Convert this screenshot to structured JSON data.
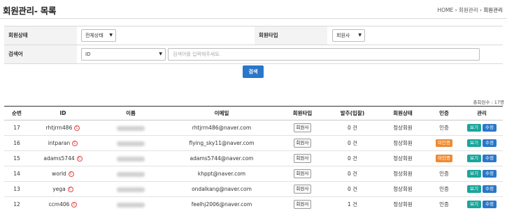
{
  "page": {
    "title": "회원관리- 목록",
    "breadcrumb": {
      "home": "HOME",
      "sep": "›",
      "parent": "회원관리",
      "current": "회원관리"
    }
  },
  "filters": {
    "status_label": "회원상태",
    "status_value": "전체상태",
    "type_label": "회원타입",
    "type_value": "회원사",
    "search_label": "검색어",
    "search_field": "ID",
    "search_placeholder": "검색어를 입력해주세요.",
    "search_button": "검색"
  },
  "total_text": "총회원수 : 17명",
  "table": {
    "headers": [
      "순번",
      "ID",
      "이름",
      "이메일",
      "회원타입",
      "발주(입찰)",
      "회원상태",
      "인증",
      "관리"
    ],
    "rows": [
      {
        "no": "17",
        "id": "rhtjrrn486",
        "email": "rhtjrrn486@naver.com",
        "type": "회원사",
        "orders": "0 건",
        "status": "정상회원",
        "cert": "인증",
        "cert_pending": false
      },
      {
        "no": "16",
        "id": "intparan",
        "email": "flying_sky11@naver.com",
        "type": "회원사",
        "orders": "0 건",
        "status": "정상회원",
        "cert": "미인증",
        "cert_pending": true
      },
      {
        "no": "15",
        "id": "adams5744",
        "email": "adams5744@naver.com",
        "type": "회원사",
        "orders": "0 건",
        "status": "정상회원",
        "cert": "미인증",
        "cert_pending": true
      },
      {
        "no": "14",
        "id": "world",
        "email": "khppt@naver.com",
        "type": "회원사",
        "orders": "0 건",
        "status": "정상회원",
        "cert": "인증",
        "cert_pending": false
      },
      {
        "no": "13",
        "id": "yega",
        "email": "ondalkang@naver.com",
        "type": "회원사",
        "orders": "0 건",
        "status": "정상회원",
        "cert": "인증",
        "cert_pending": false
      },
      {
        "no": "12",
        "id": "ccm406",
        "email": "feelhj2006@naver.com",
        "type": "회원사",
        "orders": "1 건",
        "status": "정상회원",
        "cert": "인증",
        "cert_pending": false
      }
    ],
    "icon_letter": "C",
    "view_label": "보기",
    "edit_label": "수정"
  },
  "colors": {
    "primary": "#2a77c9",
    "view": "#1ba59a",
    "pending": "#ef8a2f",
    "icon": "#e04848"
  },
  "icons": {
    "id_badge": "c-circle-icon",
    "caret": "caret-down-icon"
  }
}
